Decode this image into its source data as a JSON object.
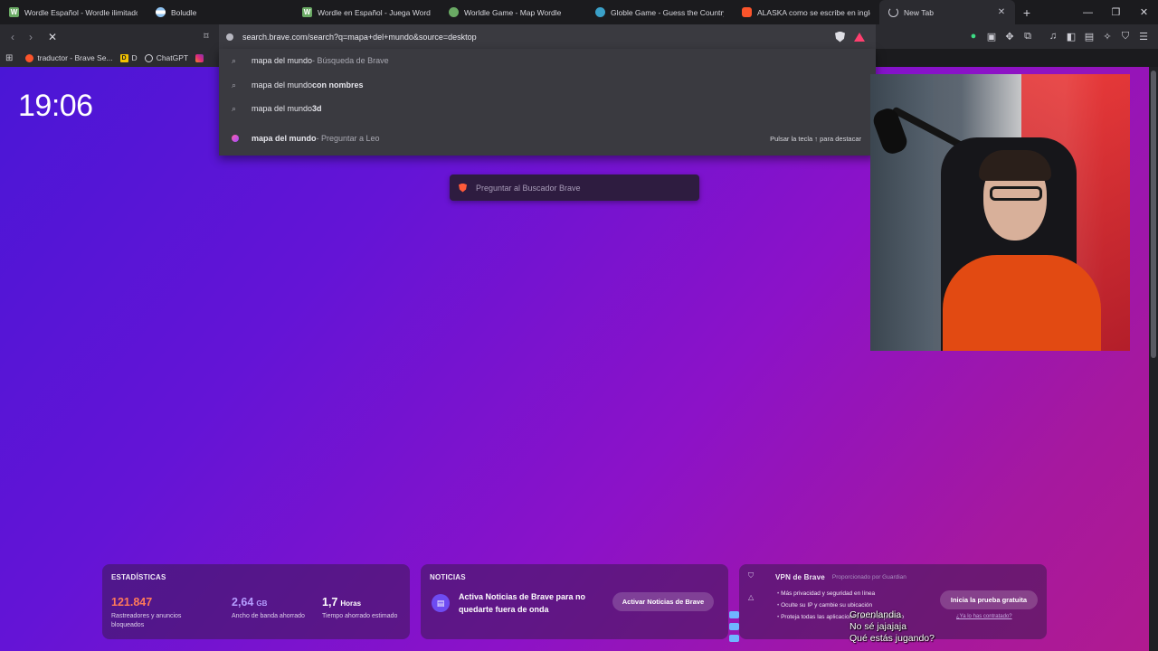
{
  "tabs": [
    {
      "title": "Wordle Español - Wordle ilimitado e",
      "icon": "wordle-icon",
      "fav": "W"
    },
    {
      "title": "Boludle",
      "icon": "argentina-flag-icon",
      "fav": ""
    },
    {
      "title": "Wordle en Español - Juega Wordle o",
      "icon": "wordle-icon",
      "fav": "W"
    },
    {
      "title": "Worldle Game - Map Wordle",
      "icon": "map-icon",
      "fav": ""
    },
    {
      "title": "Globle Game - Guess the Country",
      "icon": "globe-icon",
      "fav": ""
    },
    {
      "title": "ALASKA como se escribe en ingles -",
      "icon": "brave-icon",
      "fav": ""
    },
    {
      "title": "New Tab",
      "icon": "loading-spinner-icon",
      "fav": "",
      "active": true
    }
  ],
  "window": {
    "new_tab": "+",
    "minimize": "—",
    "restore": "❐",
    "close": "✕",
    "tab_close": "✕"
  },
  "toolbar": {
    "back": "‹",
    "forward": "›",
    "stop": "✕",
    "bookmark": "🔖",
    "url": "search.brave.com/search?q=mapa+del+mundo&source=desktop"
  },
  "bookmarks": [
    {
      "label": "traductor - Brave Se...",
      "icon": "brave-icon"
    },
    {
      "label": "D",
      "icon": "yellow-bookmark-icon",
      "fav": "D"
    },
    {
      "label": "ChatGPT",
      "icon": "chatgpt-icon"
    },
    {
      "label": "",
      "icon": "instagram-icon"
    }
  ],
  "suggestions": [
    {
      "bold": "mapa del mundo",
      "rest": " - Búsqueda de Brave",
      "rest_style": "grey",
      "icon": "search-icon"
    },
    {
      "bold": "mapa del mundo",
      "rest": " con nombres",
      "rest_style": "bold",
      "icon": "search-icon"
    },
    {
      "bold": "mapa del mundo",
      "rest": " 3d",
      "rest_style": "bold",
      "icon": "search-icon"
    },
    {
      "bold": "mapa del mundo",
      "rest": " - Preguntar a Leo",
      "rest_style": "grey",
      "icon": "leo-icon",
      "hint": "Pulsar la tecla ↑ para destacar"
    }
  ],
  "clock": "19:06",
  "ask_placeholder": "Preguntar al Buscador Brave",
  "stats": {
    "title": "ESTADÍSTICAS",
    "items": [
      {
        "value": "121.847",
        "unit": "",
        "label": "Rastreadores y anuncios bloqueados",
        "color": "#ff7a59"
      },
      {
        "value": "2,64",
        "unit": "GB",
        "label": "Ancho de banda ahorrado",
        "color": "#b59cff"
      },
      {
        "value": "1,7",
        "unit": "Horas",
        "label": "Tiempo ahorrado estimado",
        "color": "#ffffff"
      }
    ]
  },
  "news": {
    "title": "NOTICIAS",
    "text": "Activa Noticias de Brave para no quedarte fuera de onda",
    "button": "Activar Noticias de Brave"
  },
  "vpn": {
    "title": "VPN de Brave",
    "provider": "Proporcionado por Guardian",
    "features": [
      "Más privacidad y seguridad en línea",
      "Oculte su IP y cambie su ubicación",
      "Proteja todas las aplicaciones de su dispositivo"
    ],
    "button": "Inicia la prueba gratuita",
    "link": "¿Ya lo has contratado?"
  },
  "chat": [
    {
      "user": "",
      "message": "Groenlandia"
    },
    {
      "user": "",
      "message": "No sé jajajaja"
    },
    {
      "user": "",
      "message": "Qué estás jugando?"
    }
  ]
}
